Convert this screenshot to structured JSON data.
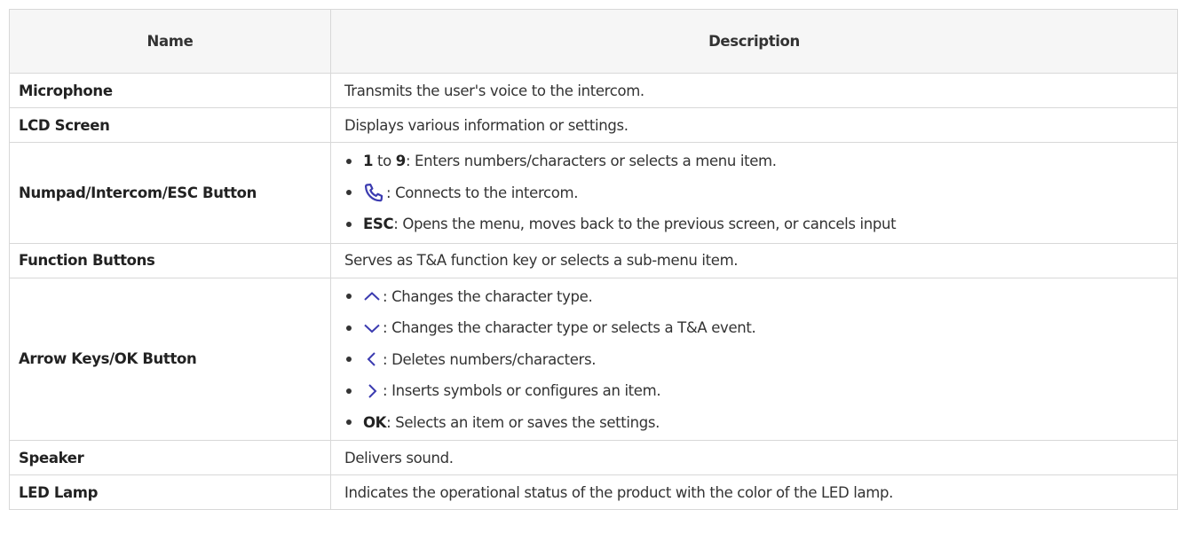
{
  "header": {
    "name": "Name",
    "description": "Description"
  },
  "rows": [
    {
      "name": "Microphone",
      "description": "Transmits the user's voice to the intercom."
    },
    {
      "name": "LCD Screen",
      "description": "Displays various information or settings."
    },
    {
      "name": "Numpad/Intercom/ESC Button",
      "items": [
        {
          "key_a": "1",
          "mid": " to ",
          "key_b": "9",
          "text": ": Enters numbers/characters or selects a menu item."
        },
        {
          "icon": "phone-icon",
          "text": ": Connects to the intercom."
        },
        {
          "key": "ESC",
          "text": ": Opens the menu, moves back to the previous screen, or cancels input"
        }
      ]
    },
    {
      "name": "Function Buttons",
      "description": "Serves as T&A function key or selects a sub-menu item."
    },
    {
      "name": "Arrow Keys/OK Button",
      "items": [
        {
          "icon": "chevron-up-icon",
          "text": ": Changes the character type."
        },
        {
          "icon": "chevron-down-icon",
          "text": ": Changes the character type or selects a T&A event."
        },
        {
          "icon": "chevron-left-icon",
          "text": ": Deletes numbers/characters."
        },
        {
          "icon": "chevron-right-icon",
          "text": ": Inserts symbols or configures an item."
        },
        {
          "key": "OK",
          "text": ": Selects an item or saves the settings."
        }
      ]
    },
    {
      "name": "Speaker",
      "description": "Delivers sound."
    },
    {
      "name": "LED Lamp",
      "description": "Indicates the operational status of the product with the color of the LED lamp."
    }
  ],
  "colors": {
    "header_bg": "#f6f6f6",
    "border": "#d8d8d8",
    "text": "#333333",
    "icon": "#3b3bb0"
  }
}
